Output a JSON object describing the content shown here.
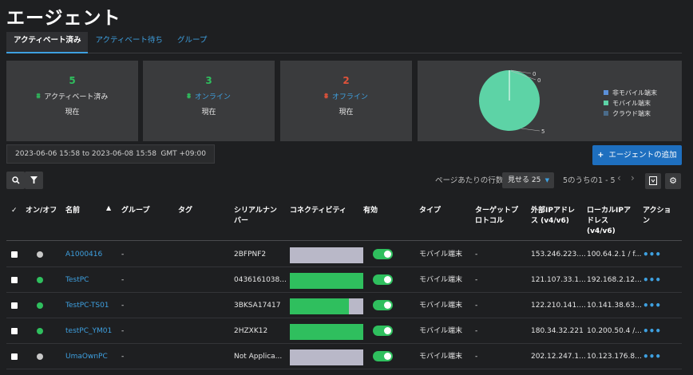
{
  "page": {
    "title": "エージェント"
  },
  "tabs": [
    {
      "label": "アクティベート済み",
      "active": true
    },
    {
      "label": "アクティベート待ち",
      "active": false
    },
    {
      "label": "グループ",
      "active": false
    }
  ],
  "cards": [
    {
      "value": "5",
      "label": "アクティベート済み",
      "sub": "現在",
      "color": "#2fbf5e"
    },
    {
      "value": "3",
      "label": "オンライン",
      "sub": "現在",
      "color": "#2fbf5e"
    },
    {
      "value": "2",
      "label": "オフライン",
      "sub": "現在",
      "color": "#e0523a"
    }
  ],
  "pie": {
    "labels": [
      "0",
      "0",
      "5"
    ],
    "legend": [
      {
        "label": "非モバイル端末",
        "color": "#5b8fd9"
      },
      {
        "label": "モバイル端末",
        "color": "#5dd3a6"
      },
      {
        "label": "クラウド端末",
        "color": "#4a6b8a"
      }
    ]
  },
  "daterange": {
    "range": "2023-06-06 15:58 to 2023-06-08 15:58",
    "tz": "GMT +09:00"
  },
  "add_button": "エージェントの追加",
  "pager": {
    "rows_label": "ページあたりの行数",
    "select": "見せる 25",
    "range": "5のうちの1 - 5"
  },
  "columns": {
    "onoff": "オン/オフ",
    "name": "名前",
    "group": "グループ",
    "tag": "タグ",
    "serial": "シリアルナンバー",
    "connectivity": "コネクティビティ",
    "enabled": "有効",
    "type": "タイプ",
    "protocol": "ターゲットプロトコル",
    "extip": "外部IPアドレス (v4/v6)",
    "localip": "ローカルIPアドレス (v4/v6)",
    "action": "アクション"
  },
  "rows": [
    {
      "name": "A1000416",
      "group": "-",
      "serial": "2BFPNF2",
      "online": false,
      "conn": 0,
      "type": "モバイル端末",
      "protocol": "-",
      "extip": "153.246.223....",
      "localip": "100.64.2.1 / f...",
      "action": "•••"
    },
    {
      "name": "TestPC",
      "group": "-",
      "serial": "0436161038...",
      "online": true,
      "conn": 1,
      "type": "モバイル端末",
      "protocol": "-",
      "extip": "121.107.33.1...",
      "localip": "192.168.2.12...",
      "action": "•••"
    },
    {
      "name": "TestPC-TS01",
      "group": "-",
      "serial": "3BKSA17417",
      "online": true,
      "conn": 0.8,
      "type": "モバイル端末",
      "protocol": "-",
      "extip": "122.210.141....",
      "localip": "10.141.38.63...",
      "action": "•••"
    },
    {
      "name": "testPC_YM01",
      "group": "-",
      "serial": "2HZXK12",
      "online": true,
      "conn": 1,
      "type": "モバイル端末",
      "protocol": "-",
      "extip": "180.34.32.221",
      "localip": "10.200.50.4 /...",
      "action": "•••"
    },
    {
      "name": "UmaOwnPC",
      "group": "-",
      "serial": "Not Applica...",
      "online": false,
      "conn": 0,
      "type": "モバイル端末",
      "protocol": "-",
      "extip": "202.12.247.1...",
      "localip": "10.123.176.8...",
      "action": "•••"
    }
  ]
}
